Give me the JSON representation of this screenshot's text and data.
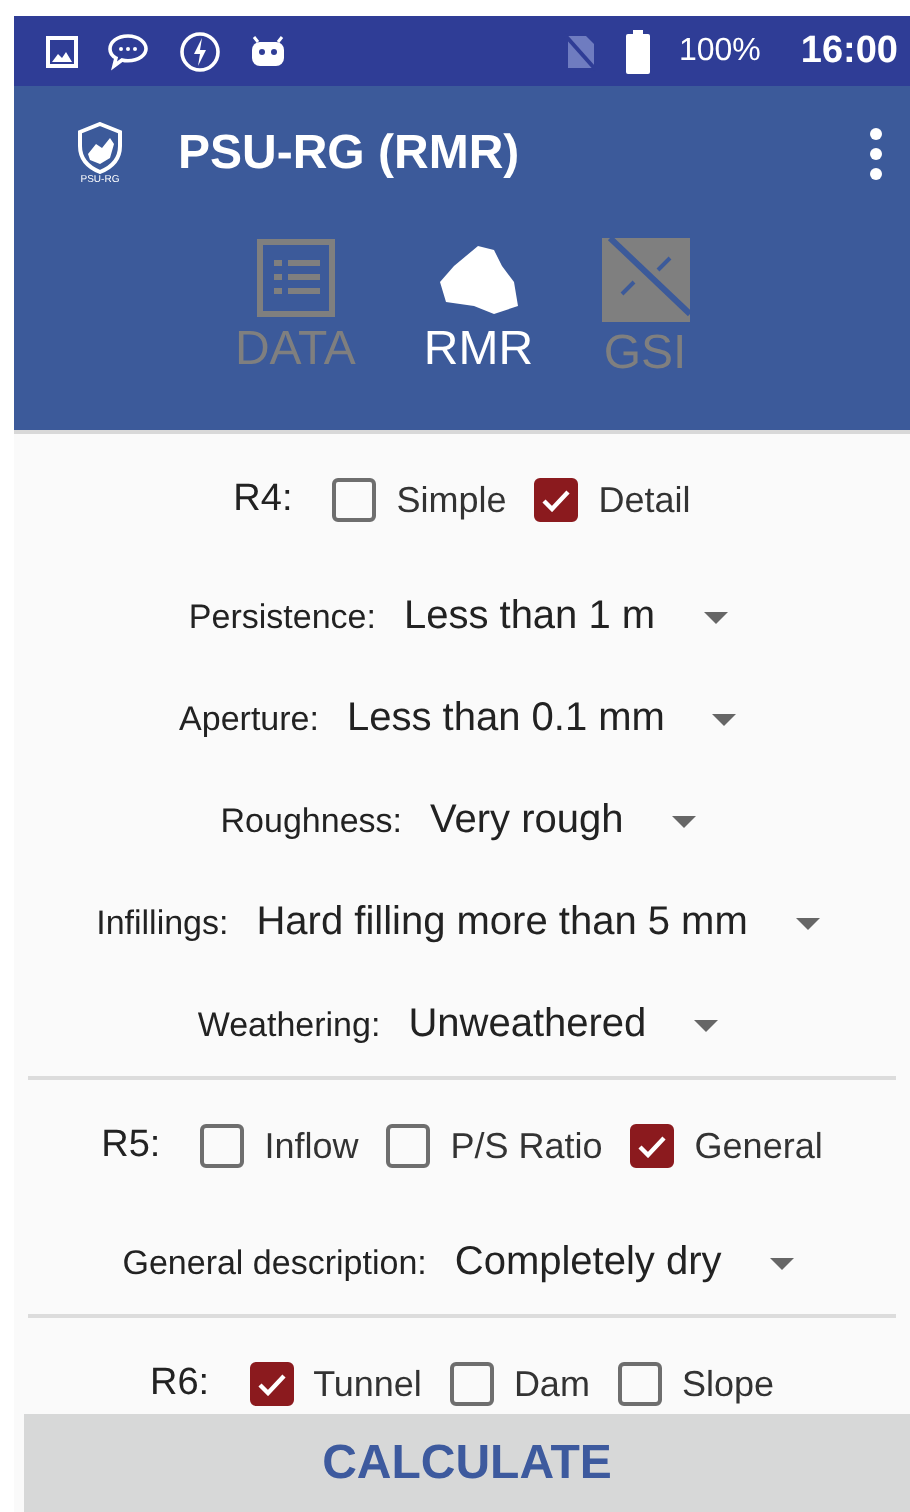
{
  "status_bar": {
    "battery": "100%",
    "time": "16:00"
  },
  "app_bar": {
    "logo_text": "PSU-RG",
    "title": "PSU-RG (RMR)"
  },
  "tabs": [
    {
      "label": "DATA",
      "kind": "list",
      "selected": false
    },
    {
      "label": "RMR",
      "kind": "rock",
      "selected": true
    },
    {
      "label": "GSI",
      "kind": "grid",
      "selected": false
    }
  ],
  "sections": [
    {
      "label": "R4:",
      "options": [
        {
          "label": "Simple",
          "checked": false
        },
        {
          "label": "Detail",
          "checked": true
        }
      ],
      "dropdowns": [
        {
          "label": "Persistence:",
          "value": "Less than 1 m"
        },
        {
          "label": "Aperture:",
          "value": "Less than 0.1 mm"
        },
        {
          "label": "Roughness:",
          "value": "Very rough"
        },
        {
          "label": "Infillings:",
          "value": "Hard filling more than 5 mm"
        },
        {
          "label": "Weathering:",
          "value": "Unweathered"
        }
      ]
    },
    {
      "label": "R5:",
      "options": [
        {
          "label": "Inflow",
          "checked": false
        },
        {
          "label": "P/S Ratio",
          "checked": false
        },
        {
          "label": "General",
          "checked": true
        }
      ],
      "dropdowns": [
        {
          "label": "General description:",
          "value": "Completely dry"
        }
      ]
    },
    {
      "label": "R6:",
      "options": [
        {
          "label": "Tunnel",
          "checked": true
        },
        {
          "label": "Dam",
          "checked": false
        },
        {
          "label": "Slope",
          "checked": false
        }
      ]
    }
  ],
  "button": "CALCULATE"
}
